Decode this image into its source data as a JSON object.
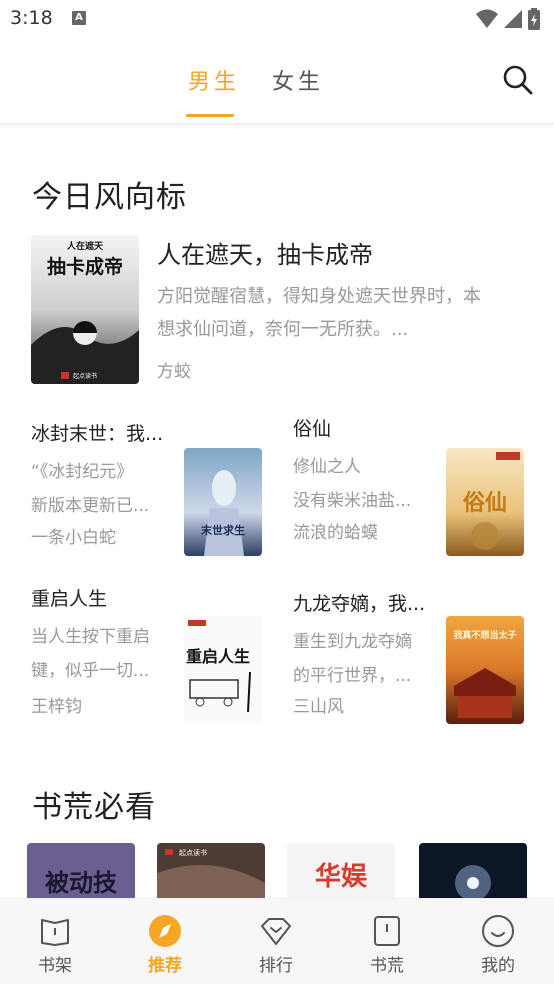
{
  "status_bar": {
    "time": "3:18",
    "notification_letter": "A"
  },
  "top_tabs": {
    "tabs": [
      {
        "label": "男生",
        "active": true
      },
      {
        "label": "女生",
        "active": false
      }
    ]
  },
  "colors": {
    "accent": "#f5a623",
    "text_primary": "#222222",
    "text_secondary": "#999999"
  },
  "section_daily": {
    "title": "今日风向标",
    "feature": {
      "title": "人在遮天，抽卡成帝",
      "desc_line1": "方阳觉醒宿慧，得知身处遮天世界时，本",
      "desc_line2": "想求仙问道，奈何一无所获。...",
      "author": "方蛟",
      "cover_top": "人在遮天",
      "cover_title": "抽卡成帝",
      "cover_publisher": "起点读书"
    },
    "cards": [
      {
        "title": "冰封末世：我...",
        "desc1": "“《冰封纪元》",
        "desc2": "新版本更新已...",
        "author": "一条小白蛇",
        "cover_text": "末世求生"
      },
      {
        "title": "俗仙",
        "desc1": "修仙之人",
        "desc2": "没有柴米油盐...",
        "author": "流浪的蛤蟆",
        "cover_text": "俗仙"
      },
      {
        "title": "重启人生",
        "desc1": "当人生按下重启",
        "desc2": "键，似乎一切...",
        "author": "王梓钧",
        "cover_text": "重启人生"
      },
      {
        "title": "九龙夺嫡，我...",
        "desc1": "重生到九龙夺嫡",
        "desc2": "的平行世界，...",
        "author": "三山风",
        "cover_text": "我真不想当太子"
      }
    ]
  },
  "section_must_read": {
    "title": "书荒必看",
    "covers": [
      {
        "text": "被动技"
      },
      {
        "text": "起点读书"
      },
      {
        "text": "华娱"
      },
      {
        "text": ""
      }
    ]
  },
  "bottom_nav": {
    "items": [
      {
        "label": "书架",
        "icon": "bookshelf-icon",
        "active": false
      },
      {
        "label": "推荐",
        "icon": "compass-icon",
        "active": true
      },
      {
        "label": "排行",
        "icon": "ranking-icon",
        "active": false
      },
      {
        "label": "书荒",
        "icon": "book-icon",
        "active": false
      },
      {
        "label": "我的",
        "icon": "profile-icon",
        "active": false
      }
    ]
  }
}
